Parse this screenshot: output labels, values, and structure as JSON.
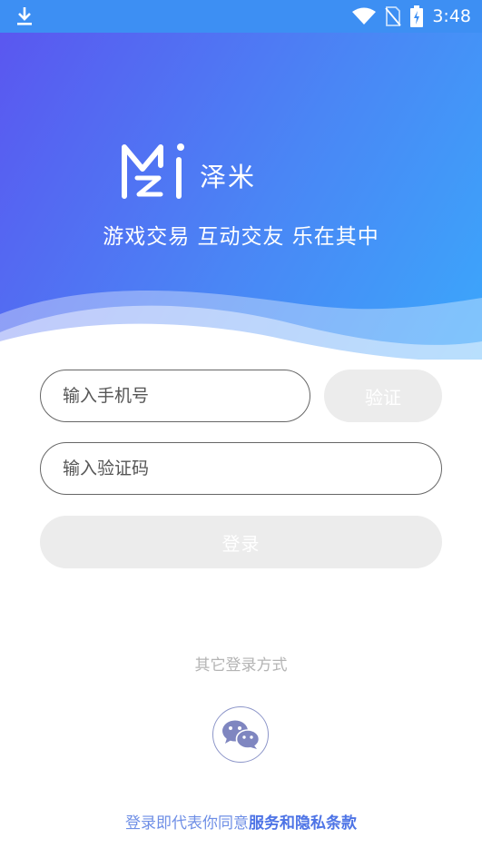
{
  "status_bar": {
    "time": "3:48"
  },
  "hero": {
    "brand": "泽米",
    "slogan": "游戏交易 互动交友 乐在其中"
  },
  "form": {
    "phone_placeholder": "输入手机号",
    "verify_label": "验证",
    "code_placeholder": "输入验证码",
    "login_label": "登录"
  },
  "other_login": {
    "label": "其它登录方式"
  },
  "terms": {
    "prefix": "登录即代表你同意",
    "link": "服务和隐私条款"
  },
  "colors": {
    "gradient_start": "#5a57f0",
    "gradient_end": "#3ba7fb",
    "link": "#4e74e6"
  }
}
